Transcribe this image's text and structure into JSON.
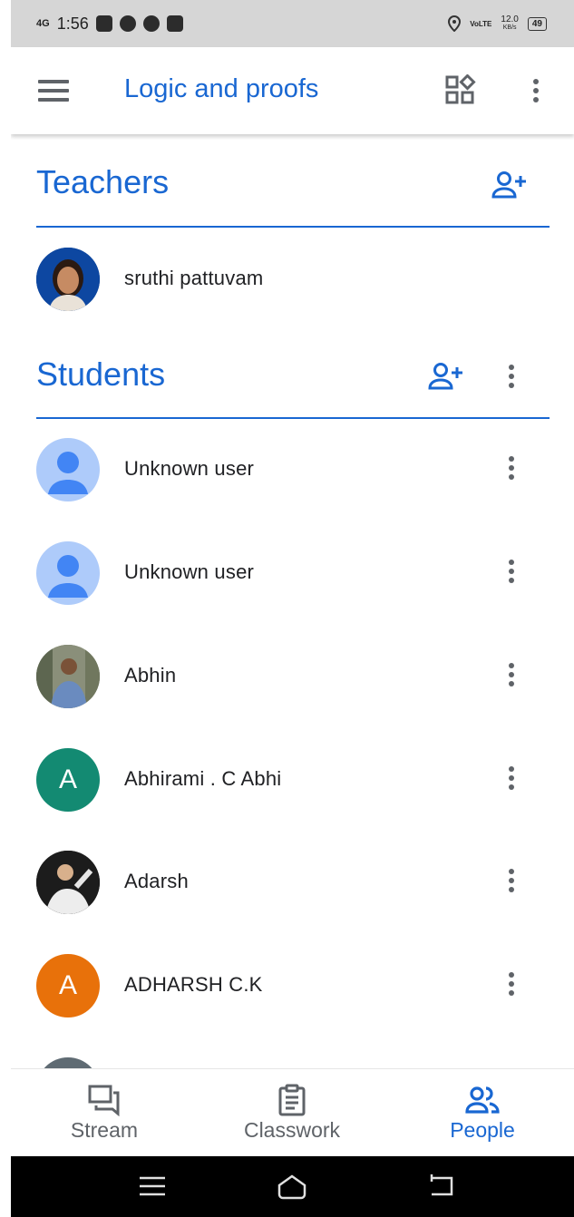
{
  "status_bar": {
    "network": "4G",
    "time": "1:56",
    "lte": "VoLTE",
    "speed_value": "12.0",
    "speed_unit": "KB/s",
    "battery": "49"
  },
  "app_bar": {
    "title": "Logic and proofs"
  },
  "teachers": {
    "title": "Teachers",
    "items": [
      {
        "name": "sruthi pattuvam",
        "avatar": "photo"
      }
    ]
  },
  "students": {
    "title": "Students",
    "items": [
      {
        "name": "Unknown user",
        "avatar": "default",
        "letter": ""
      },
      {
        "name": "Unknown user",
        "avatar": "default",
        "letter": ""
      },
      {
        "name": "Abhin",
        "avatar": "photo",
        "letter": ""
      },
      {
        "name": "Abhirami . C Abhi",
        "avatar": "letter",
        "letter": "A",
        "color": "#138a72"
      },
      {
        "name": "Adarsh",
        "avatar": "photo",
        "letter": ""
      },
      {
        "name": "ADHARSH C.K",
        "avatar": "letter",
        "letter": "A",
        "color": "#e8710a"
      }
    ]
  },
  "bottom_nav": {
    "items": [
      {
        "label": "Stream",
        "icon": "stream-icon",
        "active": false
      },
      {
        "label": "Classwork",
        "icon": "classwork-icon",
        "active": false
      },
      {
        "label": "People",
        "icon": "people-icon",
        "active": true
      }
    ]
  },
  "colors": {
    "accent": "#1967d2",
    "icon_gray": "#5f6368",
    "default_avatar_bg": "#aecbfa",
    "default_avatar_fg": "#4285f4"
  }
}
